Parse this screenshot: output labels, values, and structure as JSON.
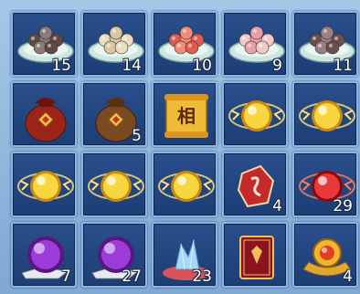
{
  "inventory": {
    "rows": [
      [
        {
          "name": "plate-gray-dumplings-icon",
          "count": "15",
          "colors": [
            "#5d4a45",
            "#8a7a78"
          ]
        },
        {
          "name": "plate-white-dumplings-icon",
          "count": "14",
          "colors": [
            "#e8ddc0",
            "#d7c8a4"
          ]
        },
        {
          "name": "plate-red-dumplings-icon",
          "count": "10",
          "colors": [
            "#e05b50",
            "#f08a7a"
          ]
        },
        {
          "name": "plate-pink-dumplings-icon",
          "count": "9",
          "colors": [
            "#f1c9c9",
            "#e8a0a8"
          ]
        },
        {
          "name": "plate-brown-dumplings-icon",
          "count": "11",
          "colors": [
            "#6a5050",
            "#9a8080"
          ]
        }
      ],
      [
        {
          "name": "red-lucky-bag-icon",
          "count": ""
        },
        {
          "name": "brown-lucky-bag-icon",
          "count": "5"
        },
        {
          "name": "gold-scroll-icon",
          "count": "",
          "glyph": "相"
        },
        {
          "name": "gold-orb-icon",
          "count": ""
        },
        {
          "name": "gold-orb-icon",
          "count": ""
        }
      ],
      [
        {
          "name": "gold-orb-icon",
          "count": ""
        },
        {
          "name": "gold-orb-icon",
          "count": ""
        },
        {
          "name": "gold-orb-icon",
          "count": ""
        },
        {
          "name": "red-rune-stone-icon",
          "count": "4"
        },
        {
          "name": "red-orb-icon",
          "count": "29"
        }
      ],
      [
        {
          "name": "purple-orb-icon",
          "count": "7"
        },
        {
          "name": "purple-orb-icon",
          "count": "27"
        },
        {
          "name": "blue-crystal-icon",
          "count": "23"
        },
        {
          "name": "red-book-icon",
          "count": ""
        },
        {
          "name": "gold-medal-icon",
          "count": "4"
        }
      ]
    ]
  }
}
